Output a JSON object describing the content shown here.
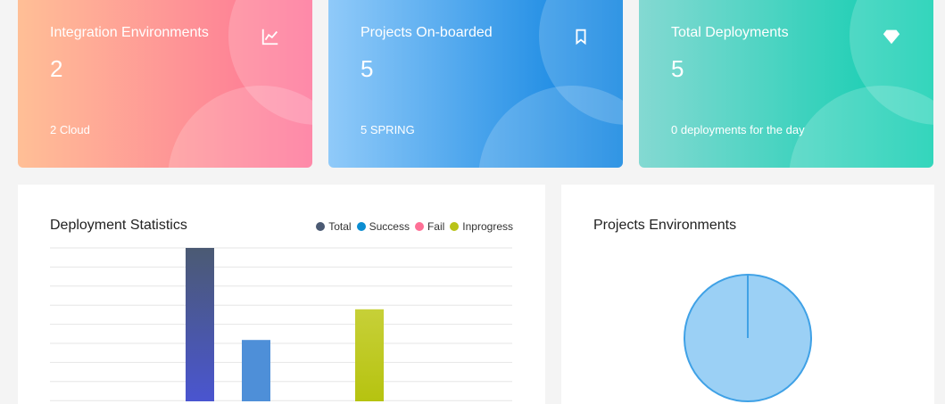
{
  "cards": [
    {
      "title": "Integration Environments",
      "value": "2",
      "footer": "2 Cloud",
      "icon": "line-chart-icon"
    },
    {
      "title": "Projects On-boarded",
      "value": "5",
      "footer": "5 SPRING",
      "icon": "bookmark-icon"
    },
    {
      "title": "Total Deployments",
      "value": "5",
      "footer": "0 deployments for the day",
      "icon": "diamond-icon"
    }
  ],
  "deployment_panel": {
    "title": "Deployment Statistics",
    "legend": [
      {
        "label": "Total",
        "color": "#4b5a73"
      },
      {
        "label": "Success",
        "color": "#0b8dd1"
      },
      {
        "label": "Fail",
        "color": "#fe7096"
      },
      {
        "label": "Inprogress",
        "color": "#b9c318"
      }
    ]
  },
  "environments_panel": {
    "title": "Projects Environments"
  },
  "chart_data": [
    {
      "type": "bar",
      "title": "Deployment Statistics",
      "categories": [
        "Total",
        "Success",
        "Fail",
        "Inprogress"
      ],
      "values": [
        5,
        2,
        0,
        3
      ],
      "colors": [
        "#4b5a73",
        "#4e8fd8",
        "#fe7096",
        "#c3cc24"
      ],
      "ylim": [
        0,
        5
      ],
      "grid": true,
      "legend_position": "top-right"
    },
    {
      "type": "pie",
      "title": "Projects Environments",
      "values": [
        100
      ],
      "colors": [
        "#9bd0f5"
      ]
    }
  ]
}
